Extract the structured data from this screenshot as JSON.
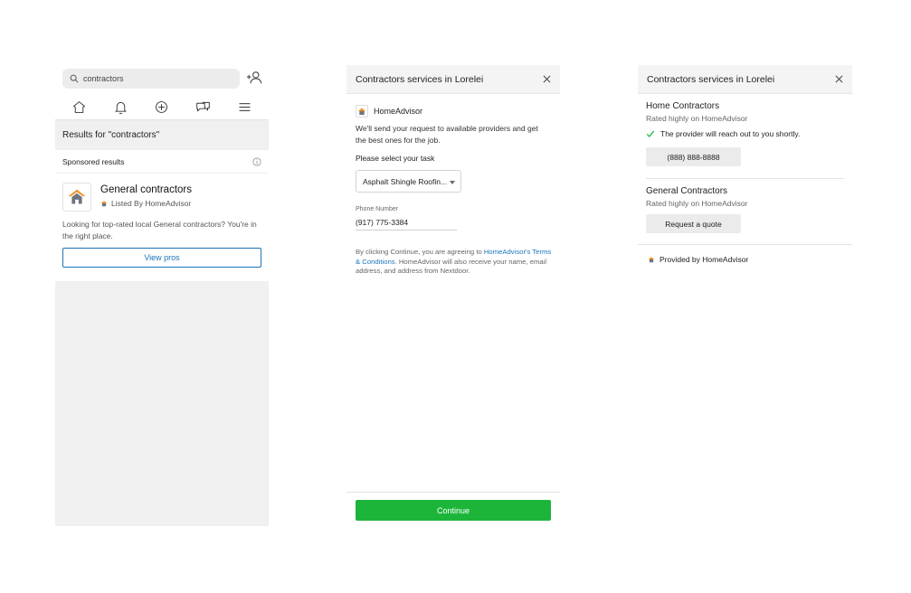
{
  "colors": {
    "accent_blue": "#1a76b8",
    "continue_green": "#1cb53a",
    "homeadvisor_orange": "#f0901e",
    "homeadvisor_gray": "#6d7580"
  },
  "screen1": {
    "search": {
      "value": "contractors",
      "icon": "search-icon"
    },
    "nav_icons": [
      "home-icon",
      "bell-icon",
      "plus-circle-icon",
      "chat-icon",
      "menu-icon"
    ],
    "results_heading": "Results for \"contractors\"",
    "sponsored_label": "Sponsored results",
    "listing": {
      "title": "General contractors",
      "listed_by": "Listed By HomeAdvisor",
      "description": "Looking for top-rated local General contractors? You're in the right place.",
      "button": "View pros"
    }
  },
  "screen2": {
    "title": "Contractors services in Lorelei",
    "brand": "HomeAdvisor",
    "description": "We'll send your request to available providers and get the best ones for the job.",
    "task_label": "Please select your task",
    "task_value": "Asphalt Shingle Roofin...",
    "phone_label": "Phone Number",
    "phone_value": "(917) 775-3384",
    "legal_prefix": "By clicking Continue, you are agreeing to ",
    "legal_link": "HomeAdvisor's Terms & Conditions",
    "legal_suffix": ". HomeAdvisor will also receive your name, email address, and address from Nextdoor.",
    "continue_button": "Continue"
  },
  "screen3": {
    "title": "Contractors services in Lorelei",
    "providers": [
      {
        "name": "Home Contractors",
        "rating": "Rated highly on HomeAdvisor",
        "status": "The provider will reach out to you shortly.",
        "button": "(888) 888-8888"
      },
      {
        "name": "General Contractors",
        "rating": "Rated highly on HomeAdvisor",
        "button": "Request a quote"
      }
    ],
    "provided_by": "Provided by HomeAdvisor"
  }
}
